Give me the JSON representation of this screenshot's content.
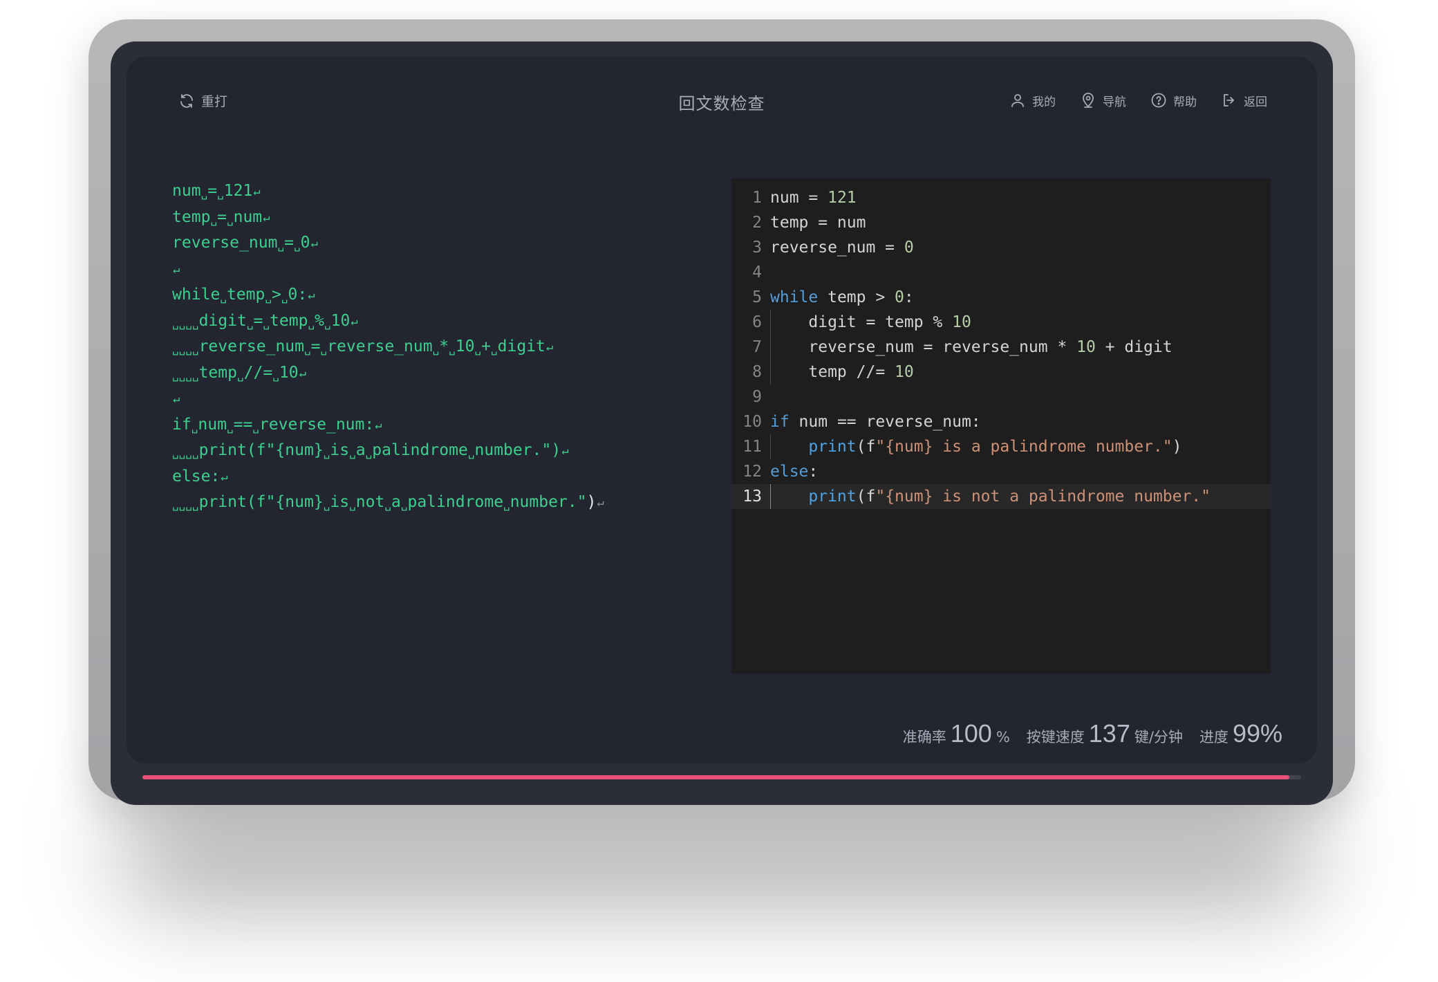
{
  "header": {
    "restart_label": "重打",
    "title": "回文数检查",
    "nav": [
      {
        "icon": "user-icon",
        "label": "我的"
      },
      {
        "icon": "location-pin-icon",
        "label": "导航"
      },
      {
        "icon": "help-icon",
        "label": "帮助"
      },
      {
        "icon": "logout-icon",
        "label": "返回"
      }
    ]
  },
  "typed_lines": [
    "num = 121",
    "temp = num",
    "reverse_num = 0",
    "",
    "while temp > 0:",
    "    digit = temp % 10",
    "    reverse_num = reverse_num * 10 + digit",
    "    temp //= 10",
    "",
    "if num == reverse_num:",
    "    print(f\"{num} is a palindrome number.\")",
    "else:",
    "    print(f\"{num} is not a palindrome number.\")"
  ],
  "editor": {
    "active_line": 13,
    "lines": [
      {
        "n": "1",
        "indent": false,
        "tokens": [
          [
            "t",
            "num = "
          ],
          [
            "num",
            "121"
          ]
        ]
      },
      {
        "n": "2",
        "indent": false,
        "tokens": [
          [
            "t",
            "temp = num"
          ]
        ]
      },
      {
        "n": "3",
        "indent": false,
        "tokens": [
          [
            "t",
            "reverse_num = "
          ],
          [
            "num",
            "0"
          ]
        ]
      },
      {
        "n": "4",
        "indent": false,
        "tokens": []
      },
      {
        "n": "5",
        "indent": false,
        "tokens": [
          [
            "kw",
            "while"
          ],
          [
            "t",
            " temp > "
          ],
          [
            "num",
            "0"
          ],
          [
            "t",
            ":"
          ]
        ]
      },
      {
        "n": "6",
        "indent": true,
        "tokens": [
          [
            "t",
            "    digit = temp % "
          ],
          [
            "num",
            "10"
          ]
        ]
      },
      {
        "n": "7",
        "indent": true,
        "tokens": [
          [
            "t",
            "    reverse_num = reverse_num * "
          ],
          [
            "num",
            "10"
          ],
          [
            "t",
            " + digit"
          ]
        ]
      },
      {
        "n": "8",
        "indent": true,
        "tokens": [
          [
            "t",
            "    temp //= "
          ],
          [
            "num",
            "10"
          ]
        ]
      },
      {
        "n": "9",
        "indent": false,
        "tokens": []
      },
      {
        "n": "10",
        "indent": false,
        "tokens": [
          [
            "kw",
            "if"
          ],
          [
            "t",
            " num == reverse_num:"
          ]
        ]
      },
      {
        "n": "11",
        "indent": true,
        "tokens": [
          [
            "t",
            "    "
          ],
          [
            "fn",
            "print"
          ],
          [
            "t",
            "(f"
          ],
          [
            "str",
            "\"{num} is a palindrome number.\""
          ],
          [
            "t",
            ")"
          ]
        ]
      },
      {
        "n": "12",
        "indent": false,
        "tokens": [
          [
            "kw",
            "else"
          ],
          [
            "t",
            ":"
          ]
        ]
      },
      {
        "n": "13",
        "indent": true,
        "tokens": [
          [
            "t",
            "    "
          ],
          [
            "fn",
            "print"
          ],
          [
            "t",
            "(f"
          ],
          [
            "str",
            "\"{num} is not a palindrome number.\""
          ]
        ]
      }
    ]
  },
  "stats": {
    "accuracy_label": "准确率",
    "accuracy_value": "100",
    "accuracy_unit": "%",
    "speed_label": "按键速度",
    "speed_value": "137",
    "speed_unit": "键/分钟",
    "progress_label": "进度",
    "progress_value": "99%"
  },
  "progress": {
    "fraction": 0.99
  },
  "colors": {
    "accent": "#e8507a",
    "typed_text": "#3ecf8e",
    "screen_bg": "#232631",
    "editor_bg": "#1e1e1e"
  }
}
